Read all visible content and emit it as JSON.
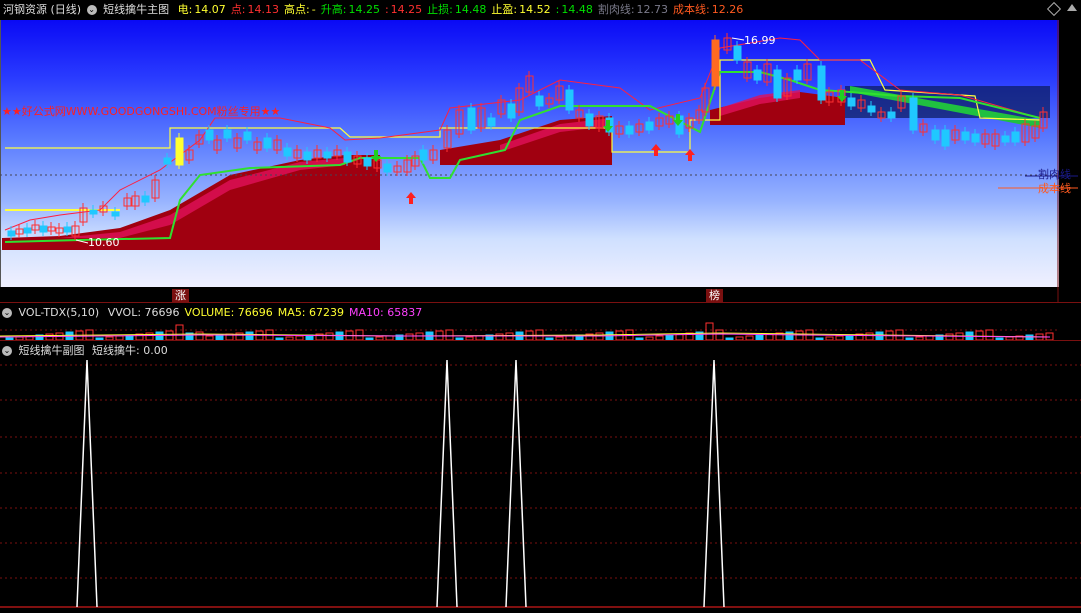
{
  "header": {
    "stock_name": "河钢资源 (日线)",
    "indicator_name": "短线擒牛主图",
    "items": [
      {
        "label": "电:",
        "value": "14.07",
        "label_color": "#ffff30",
        "value_color": "#ffff30"
      },
      {
        "label": "点:",
        "value": "14.13",
        "label_color": "#ff3030",
        "value_color": "#ff3030"
      },
      {
        "label": "高点:",
        "value": "-",
        "label_color": "#ffff30",
        "value_color": "#ffff30"
      },
      {
        "label": "升高:",
        "value": "14.25",
        "label_color": "#00e000",
        "value_color": "#00e000"
      },
      {
        "label": ":",
        "value": "14.25",
        "label_color": "#ff3030",
        "value_color": "#ff3030"
      },
      {
        "label": "止损:",
        "value": "14.48",
        "label_color": "#00e000",
        "value_color": "#00e000"
      },
      {
        "label": "止盈:",
        "value": "14.52",
        "label_color": "#ffff30",
        "value_color": "#ffff30"
      },
      {
        "label": ":",
        "value": "14.48",
        "label_color": "#00e000",
        "value_color": "#00e000"
      },
      {
        "label": "割肉线:",
        "value": "12.73",
        "label_color": "#7a7a8a",
        "value_color": "#7a7a8a"
      },
      {
        "label": "成本线:",
        "value": "12.26",
        "label_color": "#ff5a20",
        "value_color": "#ff5a20"
      }
    ]
  },
  "main": {
    "watermark": "★★好公式网WWW.GOODGONGSHI.COM粉丝专用★★",
    "high_label": "16.99",
    "low_label": "10.60",
    "cut_line_label": "割肉线",
    "cost_line_label": "成本线",
    "marker_zhang": "涨",
    "marker_bang": "榜"
  },
  "volume": {
    "name": "VOL-TDX(5,10)",
    "items": [
      {
        "label": "VVOL:",
        "value": "76696",
        "color": "#ddd"
      },
      {
        "label": "VOLUME:",
        "value": "76696",
        "color": "#ffff30"
      },
      {
        "label": "MA5:",
        "value": "67239",
        "color": "#ffff30"
      },
      {
        "label": "MA10:",
        "value": "65837",
        "color": "#ff40ff"
      }
    ]
  },
  "sub": {
    "name": "短线擒牛副图",
    "label": "短线擒牛:",
    "value": "0.00",
    "spikes": [
      87,
      447,
      516,
      714
    ]
  },
  "colors": {
    "up": "#ff3030",
    "down": "#20c8ff",
    "dark_red": "#a00010",
    "green_line": "#30e030",
    "yellow_line": "#ffff40"
  }
}
